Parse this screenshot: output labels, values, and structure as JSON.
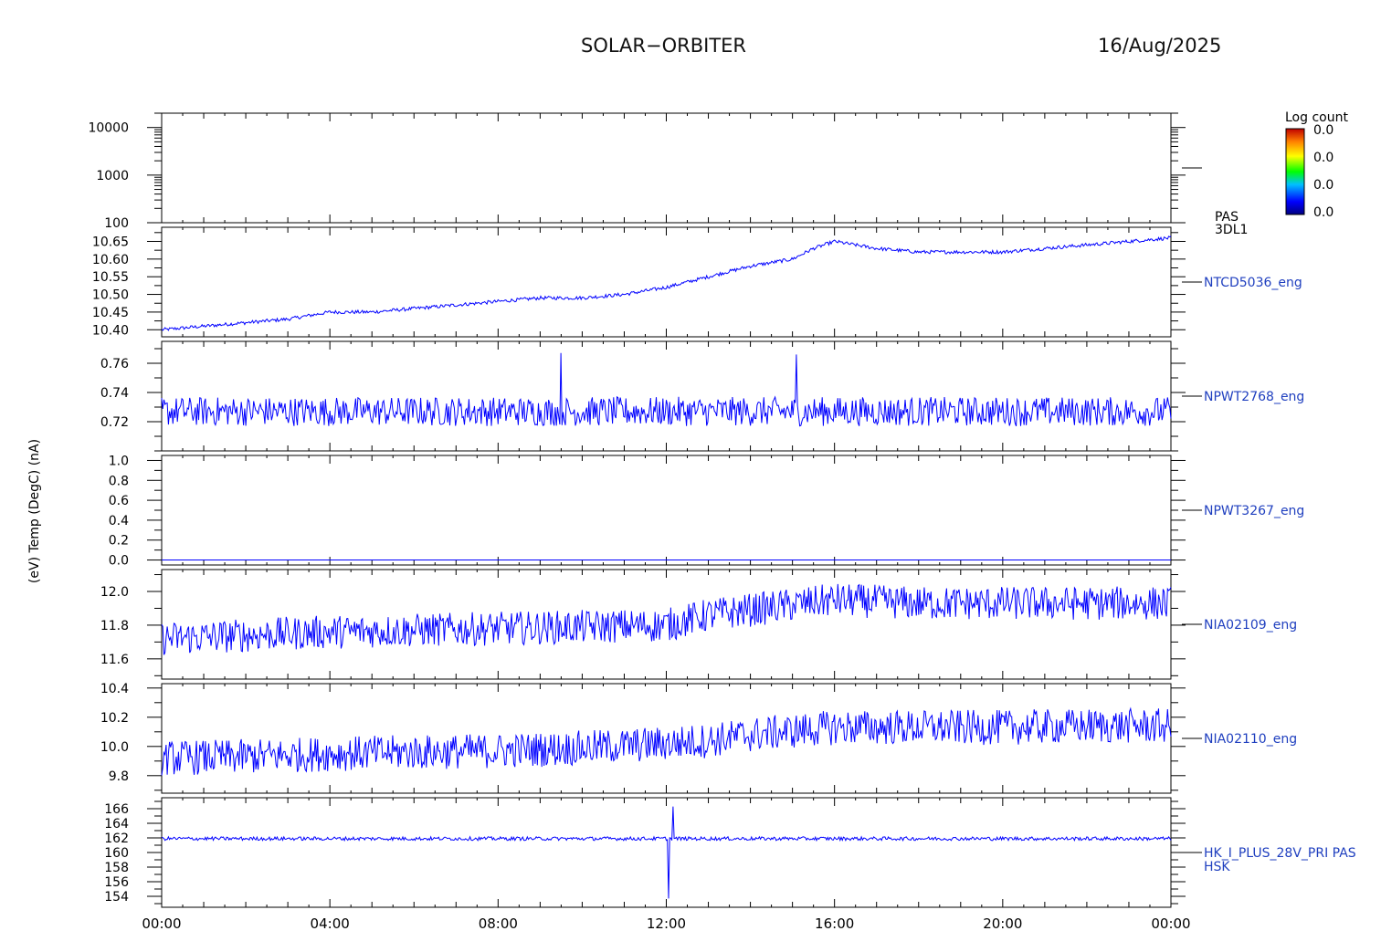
{
  "header": {
    "mission": "SOLAR−ORBITER",
    "date": "16/Aug/2025"
  },
  "colorbar": {
    "title": "Log count",
    "labels": [
      "0.0",
      "0.0",
      "0.0",
      "0.0"
    ]
  },
  "left_axis_label_overlap": "(nA)",
  "colors": {
    "trace": "#0000ff",
    "label": "#1f3fbf",
    "axis": "#000000"
  },
  "chart_data": [
    {
      "type": "heatmap",
      "panel_id": "pas",
      "ylabel": "(eV)",
      "yscale": "log",
      "ylim": [
        100,
        20000
      ],
      "yticks": [
        100,
        1000,
        10000
      ],
      "ytick_labels": [
        "100",
        "1000",
        "10000"
      ],
      "right_labels": [
        "PAS",
        "3DL1"
      ],
      "values": []
    },
    {
      "type": "line",
      "panel_id": "ntcd",
      "ylabel": "Temp (DegC)",
      "ylim": [
        10.38,
        10.69
      ],
      "yticks": [
        10.4,
        10.45,
        10.5,
        10.55,
        10.6,
        10.65
      ],
      "ytick_labels": [
        "10.40",
        "10.45",
        "10.50",
        "10.55",
        "10.60",
        "10.65"
      ],
      "right_labels": [
        "NTCD5036_eng"
      ],
      "series": [
        {
          "x_hours": [
            0,
            1,
            2,
            3,
            4,
            5,
            6,
            7,
            8,
            9,
            10,
            11,
            12,
            13,
            14,
            15,
            15.5,
            16,
            16.5,
            17,
            18,
            19,
            20,
            21,
            22,
            23,
            24
          ],
          "values": [
            10.4,
            10.41,
            10.42,
            10.43,
            10.45,
            10.45,
            10.46,
            10.47,
            10.48,
            10.49,
            10.49,
            10.5,
            10.52,
            10.55,
            10.58,
            10.6,
            10.63,
            10.65,
            10.64,
            10.63,
            10.62,
            10.62,
            10.62,
            10.63,
            10.64,
            10.65,
            10.66
          ],
          "noise": 0.005
        }
      ]
    },
    {
      "type": "line",
      "panel_id": "npwt2768",
      "ylabel": "",
      "ylim": [
        0.7,
        0.775
      ],
      "yticks": [
        0.72,
        0.74,
        0.76
      ],
      "ytick_labels": [
        "0.72",
        "0.74",
        "0.76"
      ],
      "right_labels": [
        "NPWT2768_eng"
      ],
      "series": [
        {
          "x_hours": [
            0,
            24
          ],
          "values": [
            0.727,
            0.727
          ],
          "noise": 0.01,
          "spikes": [
            [
              9.5,
              0.767
            ],
            [
              15.1,
              0.766
            ]
          ]
        }
      ]
    },
    {
      "type": "line",
      "panel_id": "npwt3267",
      "ylabel": "",
      "ylim": [
        -0.05,
        1.05
      ],
      "yticks": [
        0.0,
        0.2,
        0.4,
        0.6,
        0.8,
        1.0
      ],
      "ytick_labels": [
        "0.0",
        "0.2",
        "0.4",
        "0.6",
        "0.8",
        "1.0"
      ],
      "right_labels": [
        "NPWT3267_eng"
      ],
      "series": [
        {
          "x_hours": [
            0,
            24
          ],
          "values": [
            0.0,
            0.0
          ],
          "noise": 0
        }
      ]
    },
    {
      "type": "line",
      "panel_id": "nia02109",
      "ylabel": "",
      "ylim": [
        11.48,
        12.13
      ],
      "yticks": [
        11.6,
        11.8,
        12.0
      ],
      "ytick_labels": [
        "11.6",
        "11.8",
        "12.0"
      ],
      "right_labels": [
        "NIA02109_eng"
      ],
      "series": [
        {
          "x_hours": [
            0,
            2,
            4,
            6,
            8,
            10,
            12,
            13,
            14,
            16,
            18,
            20,
            22,
            24
          ],
          "values": [
            11.72,
            11.74,
            11.76,
            11.77,
            11.78,
            11.79,
            11.8,
            11.86,
            11.89,
            11.95,
            11.93,
            11.93,
            11.93,
            11.93
          ],
          "noise": 0.1
        }
      ]
    },
    {
      "type": "line",
      "panel_id": "nia02110",
      "ylabel": "",
      "ylim": [
        9.68,
        10.43
      ],
      "yticks": [
        9.8,
        10.0,
        10.2,
        10.4
      ],
      "ytick_labels": [
        "9.8",
        "10.0",
        "10.2",
        "10.4"
      ],
      "right_labels": [
        "NIA02110_eng"
      ],
      "series": [
        {
          "x_hours": [
            0,
            2,
            4,
            6,
            8,
            10,
            12,
            13,
            14,
            16,
            18,
            20,
            22,
            24
          ],
          "values": [
            9.92,
            9.93,
            9.95,
            9.96,
            9.97,
            9.99,
            10.02,
            10.04,
            10.08,
            10.13,
            10.13,
            10.13,
            10.14,
            10.14
          ],
          "noise": 0.12
        }
      ]
    },
    {
      "type": "line",
      "panel_id": "hk_i_plus",
      "ylabel": "(nA)",
      "ylim": [
        152.5,
        167.5
      ],
      "yticks": [
        154,
        156,
        158,
        160,
        162,
        164,
        166
      ],
      "ytick_labels": [
        "154",
        "156",
        "158",
        "160",
        "162",
        "164",
        "166"
      ],
      "right_labels": [
        "HK_I_PLUS_28V_PRI PAS",
        "HSK"
      ],
      "series": [
        {
          "x_hours": [
            0,
            24
          ],
          "values": [
            161.9,
            161.9
          ],
          "noise": 0.25,
          "spikes": [
            [
              12.05,
              153.7
            ],
            [
              12.15,
              166.3
            ]
          ]
        }
      ]
    }
  ],
  "x_axis": {
    "label_hours": [
      0,
      4,
      8,
      12,
      16,
      20,
      24
    ],
    "tick_labels": [
      "00:00",
      "04:00",
      "08:00",
      "12:00",
      "16:00",
      "20:00",
      "00:00"
    ]
  }
}
